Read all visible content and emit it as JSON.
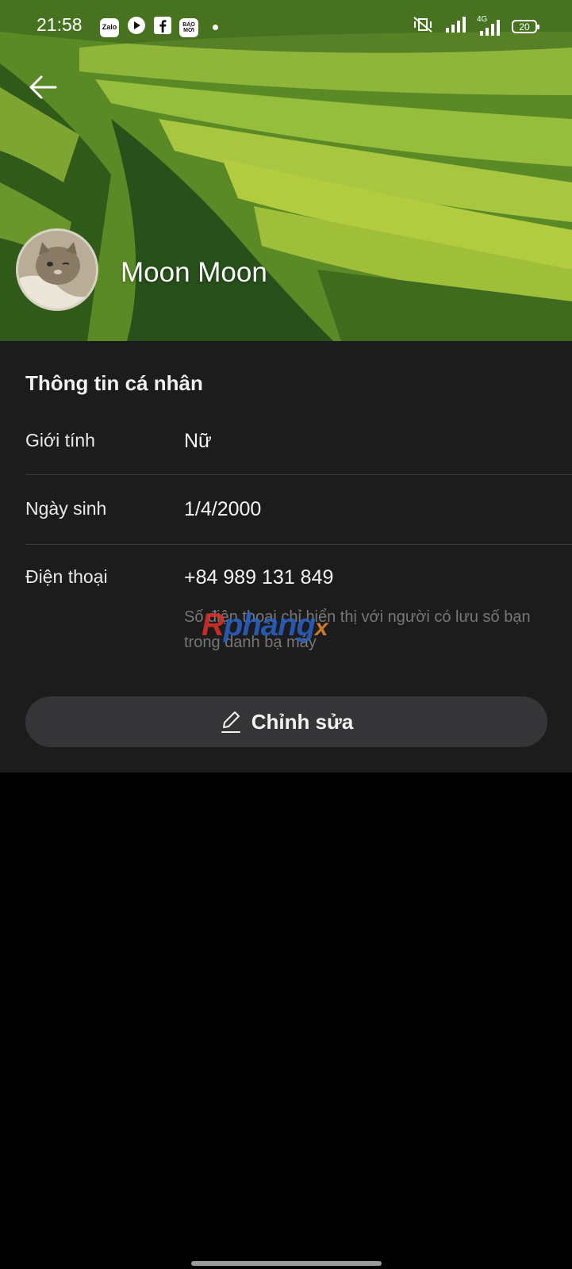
{
  "status_bar": {
    "time": "21:58",
    "apps": [
      "Zalo",
      "play-icon",
      "facebook-icon",
      "BÁO MỚI"
    ],
    "network": "4G",
    "battery": "20"
  },
  "profile": {
    "name": "Moon Moon"
  },
  "info": {
    "title": "Thông tin cá nhân",
    "gender_label": "Giới tính",
    "gender_value": "Nữ",
    "birthday_label": "Ngày sinh",
    "birthday_value": "1/4/2000",
    "phone_label": "Điện thoại",
    "phone_value": "+84 989 131 849",
    "phone_note": "Số điện thoại chỉ hiển thị với người có lưu số bạn trong danh bạ máy"
  },
  "actions": {
    "edit_label": "Chỉnh sửa"
  },
  "watermark": {
    "part1": "R",
    "part2": "phang",
    "part3": "x"
  },
  "colors": {
    "panel_bg": "#1c1c1d",
    "button_bg": "#353537",
    "page_bg": "#000000"
  }
}
